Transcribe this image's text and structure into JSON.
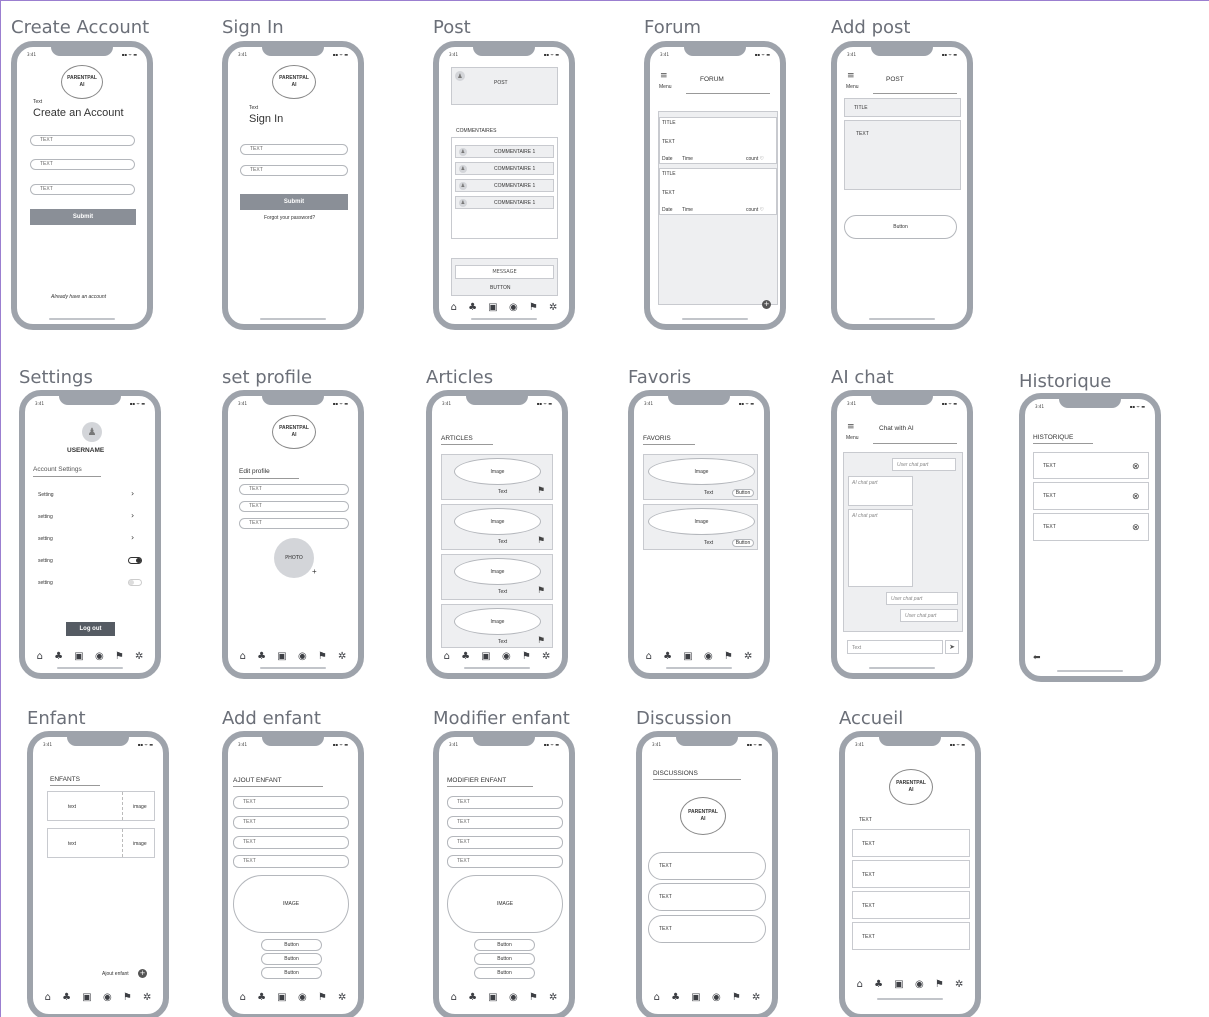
{
  "status": {
    "time": "3:41",
    "signal": "▪▪ ᯤ ▬"
  },
  "labels": {
    "text": "Text",
    "field": "TEXT",
    "button": "Button",
    "image": "Image",
    "image_lower": "image",
    "date": "Date",
    "time": "Time",
    "count": "count ♡",
    "title": "TITLE",
    "menu": "Menu",
    "plus": "+",
    "close": "⊗"
  },
  "screens": {
    "create_account": {
      "title": "Create Account",
      "logo": "PARENTPAL\nAI",
      "heading": "Create an Account",
      "submit": "Submit",
      "footer": "Already have an account"
    },
    "sign_in": {
      "title": "Sign In",
      "logo": "PARENTPAL\nAI",
      "heading": "Sign In",
      "submit": "Submit",
      "forgot": "Forgot your password?"
    },
    "post": {
      "title": "Post",
      "post_label": "POST",
      "comments_header": "COMMENTAIRES",
      "comments": [
        "COMMENTAIRE 1",
        "COMMENTAIRE 1",
        "COMMENTAIRE 1",
        "COMMENTAIRE 1"
      ],
      "message": "MESSAGE",
      "button": "BUTTON"
    },
    "forum": {
      "title": "Forum",
      "header": "FORUM"
    },
    "add_post": {
      "title": "Add post",
      "header": "POST"
    },
    "settings": {
      "title": "Settings",
      "username": "USERNAME",
      "section": "Account Settings",
      "items": [
        "Setting",
        "setting",
        "setting",
        "setting",
        "setting"
      ],
      "logout": "Log out"
    },
    "set_profile": {
      "title": "set profile",
      "logo": "PARENTPAL\nAI",
      "heading": "Edit profile",
      "photo": "PHOTO"
    },
    "articles": {
      "title": "Articles",
      "header": "ARTICLES"
    },
    "favoris": {
      "title": "Favoris",
      "header": "FAVORIS"
    },
    "ai_chat": {
      "title": "AI chat",
      "header": "Chat with AI",
      "user_msg": "User chat part",
      "ai_msg": "AI chat part",
      "input": "Text"
    },
    "historique": {
      "title": "Historique",
      "header": "HISTORIQUE"
    },
    "enfant": {
      "title": "Enfant",
      "header": "ENFANTS",
      "text": "text",
      "add": "Ajout enfant"
    },
    "add_enfant": {
      "title": "Add enfant",
      "header": "AJOUT ENFANT",
      "image": "IMAGE"
    },
    "modifier_enfant": {
      "title": "Modifier enfant",
      "header": "MODIFIER ENFANT",
      "image": "IMAGE"
    },
    "discussion": {
      "title": "Discussion",
      "header": "DISCUSSIONS",
      "logo": "PARENTPAL\nAI"
    },
    "accueil": {
      "title": "Accueil",
      "logo": "PARENTPAL\nAI"
    }
  },
  "nav_icons": [
    "⌂",
    "♣",
    "▣",
    "◉",
    "⚑",
    "✲"
  ]
}
